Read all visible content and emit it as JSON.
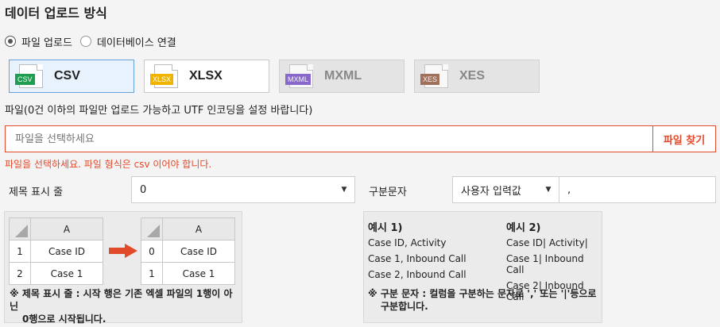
{
  "page_title": "데이터 업로드 방식",
  "upload_method": {
    "options": [
      {
        "label": "파일 업로드",
        "selected": true
      },
      {
        "label": "데이터베이스 연결",
        "selected": false
      }
    ]
  },
  "formats": [
    {
      "tag": "CSV",
      "name": "CSV",
      "color": "#1e9c4f",
      "state": "selected"
    },
    {
      "tag": "XLSX",
      "name": "XLSX",
      "color": "#f0b400",
      "state": "enabled"
    },
    {
      "tag": "MXML",
      "name": "MXML",
      "color": "#6b3fc4",
      "state": "disabled"
    },
    {
      "tag": "XES",
      "name": "XES",
      "color": "#8a4a2e",
      "state": "disabled"
    }
  ],
  "file": {
    "hint": "파일(0건 이하의 파일만 업로드 가능하고 UTF 인코딩을 설정 바랍니다)",
    "placeholder": "파일을 선택하세요",
    "button": "파일 찾기",
    "error": "파일을 선택하세요. 파일 형식은 csv 이어야 합니다."
  },
  "header_row": {
    "label": "제목 표시 줄",
    "value": "0"
  },
  "delimiter": {
    "label": "구분문자",
    "mode": "사용자 입력값",
    "value": ","
  },
  "example_sheet": {
    "column": "A",
    "left_rows": [
      {
        "n": "1",
        "v": "Case ID"
      },
      {
        "n": "2",
        "v": "Case 1"
      }
    ],
    "right_rows": [
      {
        "n": "0",
        "v": "Case ID"
      },
      {
        "n": "1",
        "v": "Case 1"
      }
    ],
    "note_line1": "※ 제목 표시 줄 : 시작 행은 기존 엑셀 파일의 1행이 아닌",
    "note_line2": "0행으로 시작됩니다."
  },
  "delimiter_examples": {
    "ex1": {
      "title": "예시 1)",
      "lines": [
        "Case ID, Activity",
        "Case 1, Inbound Call",
        "Case 2, Inbound Call"
      ]
    },
    "ex2": {
      "title": "예시 2)",
      "lines": [
        "Case ID| Activity|",
        "Case 1| Inbound Call",
        "Case 2| Inbound Call"
      ]
    },
    "note_line1": "※ 구분 문자 : 컬럼을 구분하는 문자로 ',' 또는 '|'등으로",
    "note_line2": "구분합니다."
  },
  "colors": {
    "accent": "#e24a2c",
    "arrow": "#e24a2c",
    "selected_border": "#6aa0d9"
  }
}
